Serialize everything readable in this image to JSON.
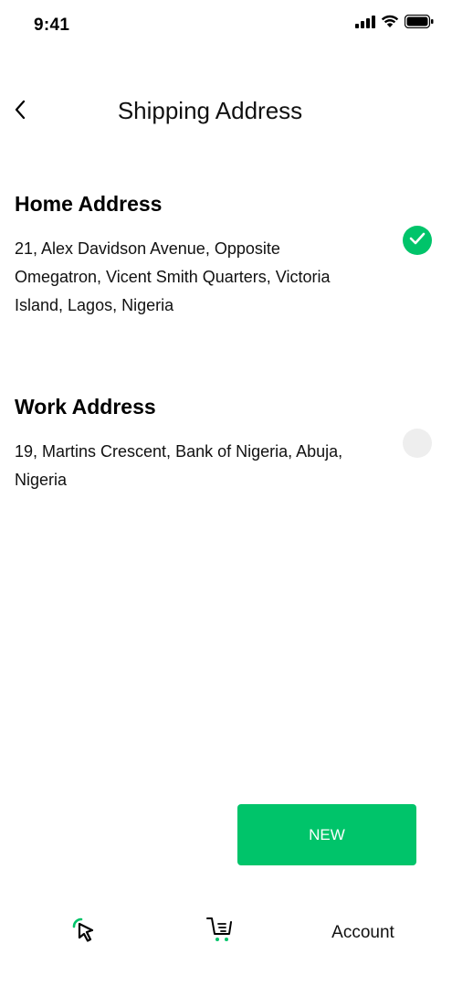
{
  "status_bar": {
    "time": "9:41"
  },
  "header": {
    "title": "Shipping Address"
  },
  "addresses": [
    {
      "title": "Home Address",
      "text": "21, Alex Davidson Avenue, Opposite Omegatron, Vicent Smith Quarters, Victoria Island, Lagos, Nigeria",
      "selected": true
    },
    {
      "title": "Work Address",
      "text": "19, Martins Crescent, Bank of Nigeria, Abuja, Nigeria",
      "selected": false
    }
  ],
  "actions": {
    "new_label": "NEW"
  },
  "bottom_nav": {
    "items": [
      {
        "icon": "cursor-icon"
      },
      {
        "icon": "cart-icon"
      },
      {
        "label": "Account",
        "active": true
      }
    ]
  },
  "colors": {
    "accent": "#00c46a",
    "unselected": "#eeeeee"
  }
}
